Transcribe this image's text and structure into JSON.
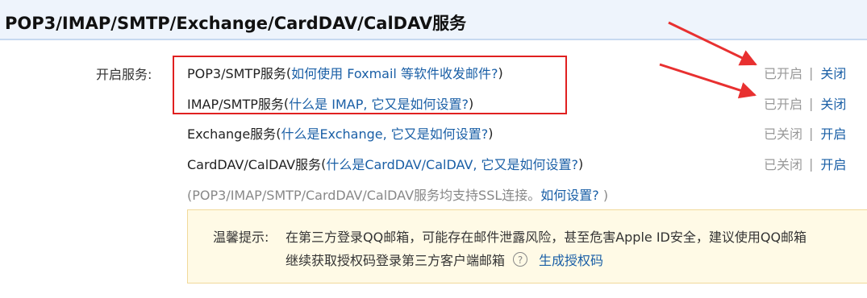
{
  "header": {
    "title": "POP3/IMAP/SMTP/Exchange/CardDAV/CalDAV服务"
  },
  "services": {
    "label": "开启服务:",
    "items": [
      {
        "name": "POP3/SMTP服务",
        "open_paren": " (",
        "link": "如何使用 Foxmail 等软件收发邮件?",
        "close_paren": " )",
        "state": "已开启",
        "sep": "|",
        "toggle": "关闭"
      },
      {
        "name": "IMAP/SMTP服务",
        "open_paren": " (",
        "link": "什么是 IMAP, 它又是如何设置?",
        "close_paren": " )",
        "state": "已开启",
        "sep": "|",
        "toggle": "关闭"
      },
      {
        "name": "Exchange服务",
        "open_paren": " (",
        "link": "什么是Exchange, 它又是如何设置?",
        "close_paren": " )",
        "state": "已关闭",
        "sep": "|",
        "toggle": "开启"
      },
      {
        "name": "CardDAV/CalDAV服务",
        "open_paren": " (",
        "link": "什么是CardDAV/CalDAV, 它又是如何设置?",
        "close_paren": " )",
        "state": "已关闭",
        "sep": "|",
        "toggle": "开启"
      }
    ],
    "ssl_note": "(POP3/IMAP/SMTP/CardDAV/CalDAV服务均支持SSL连接。",
    "ssl_link": "如何设置?",
    "ssl_close": " )"
  },
  "tip": {
    "label": "温馨提示:",
    "line1": "在第三方登录QQ邮箱，可能存在邮件泄露风险，甚至危害Apple ID安全，建议使用QQ邮箱",
    "line2": "继续获取授权码登录第三方客户端邮箱",
    "help_icon": "?",
    "action": "生成授权码"
  },
  "colors": {
    "link": "#1a5fa6",
    "highlight": "#e02020",
    "annotation_arrow": "#e83030"
  }
}
